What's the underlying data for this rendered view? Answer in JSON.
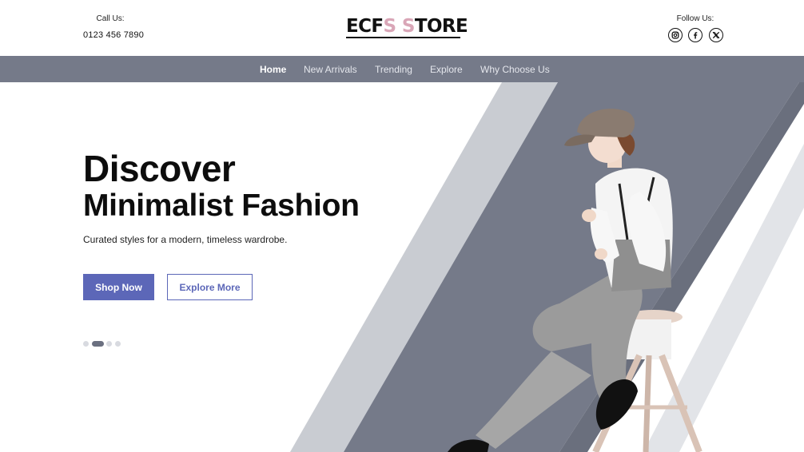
{
  "header": {
    "call_label": "Call Us:",
    "call_number": "0123 456 7890",
    "logo": {
      "part1": "ECF",
      "part2": "S S",
      "part3": "TORE"
    },
    "follow_label": "Follow Us:",
    "social": [
      "instagram-icon",
      "facebook-icon",
      "x-icon"
    ]
  },
  "nav": {
    "items": [
      "Home",
      "New Arrivals",
      "Trending",
      "Explore",
      "Why Choose Us"
    ],
    "active": "Home"
  },
  "hero": {
    "title_line1": "Discover",
    "title_line2": "Minimalist Fashion",
    "subtitle": "Curated styles for a modern, timeless wardrobe.",
    "primary_button": "Shop Now",
    "secondary_button": "Explore More",
    "slider": {
      "count": 4,
      "active_index": 1
    }
  },
  "colors": {
    "accent": "#5c67b8",
    "nav_bg": "#757a89",
    "logo_pink": "#d9a6b7",
    "stripe_light": "#c9ccd2",
    "stripe_dark": "#757a89"
  }
}
